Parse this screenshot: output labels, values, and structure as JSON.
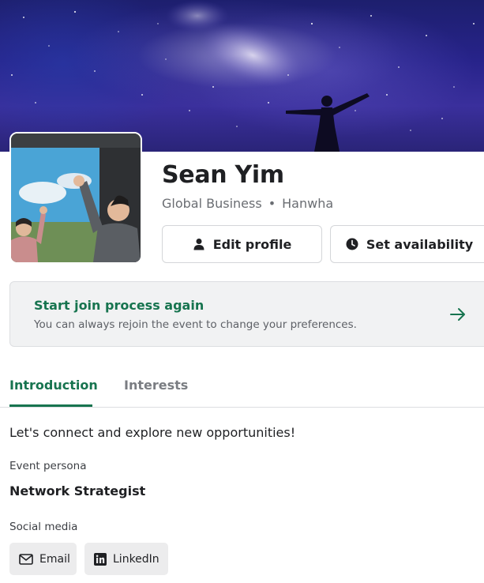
{
  "profile": {
    "name": "Sean Yim",
    "role": "Global Business",
    "separator": "•",
    "company": "Hanwha"
  },
  "actions": {
    "edit_label": "Edit profile",
    "availability_label": "Set availability"
  },
  "banner": {
    "title": "Start join process again",
    "subtitle": "You can always rejoin the event to change your preferences."
  },
  "tabs": [
    {
      "label": "Introduction",
      "active": true
    },
    {
      "label": "Interests",
      "active": false
    }
  ],
  "introduction": {
    "text": "Let's connect and explore new opportunities!",
    "persona_label": "Event persona",
    "persona_value": "Network Strategist",
    "social_label": "Social media",
    "social_links": [
      {
        "label": "Email",
        "icon": "envelope-icon"
      },
      {
        "label": "LinkedIn",
        "icon": "linkedin-icon"
      }
    ]
  },
  "colors": {
    "accent": "#17744f",
    "text": "#1f2023",
    "muted": "#6a6d72",
    "banner_bg": "#f1f2f3",
    "chip_bg": "#ececed"
  },
  "icons": {
    "edit": "person-icon",
    "availability": "clock-icon",
    "banner_action": "arrow-right-icon"
  }
}
